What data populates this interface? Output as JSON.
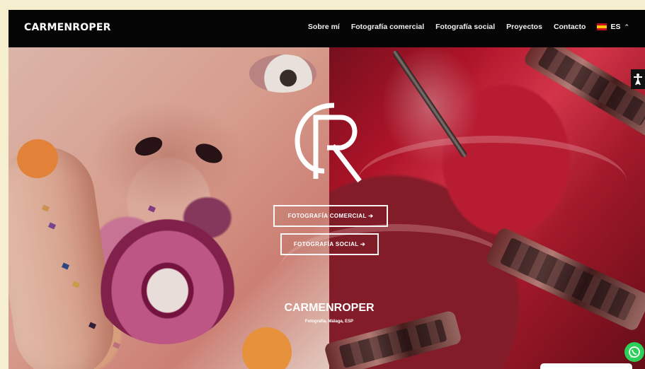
{
  "site": {
    "brand": "CARMENROPER",
    "menu": [
      "Sobre mí",
      "Fotografía comercial",
      "Fotografía social",
      "Proyectos",
      "Contacto"
    ],
    "language": "ES"
  },
  "hero": {
    "buttons": [
      "FOTOGRAFÍA COMERCIAL ➔",
      "FOTOGRAFÍA SOCIAL ➔"
    ],
    "title": "CARMENROPER",
    "subtitle": "Fotografía, Málaga, ESP"
  },
  "icons": {
    "logo": "cr-logo-icon",
    "accessibility": "accessibility-icon",
    "whatsapp": "whatsapp-icon",
    "language_flag": "spain-flag-icon",
    "language_chevron": "chevron-up-icon"
  },
  "colors": {
    "nav_bg": "#050505",
    "accent_red": "#c41e36",
    "whatsapp": "#2ecf58"
  }
}
